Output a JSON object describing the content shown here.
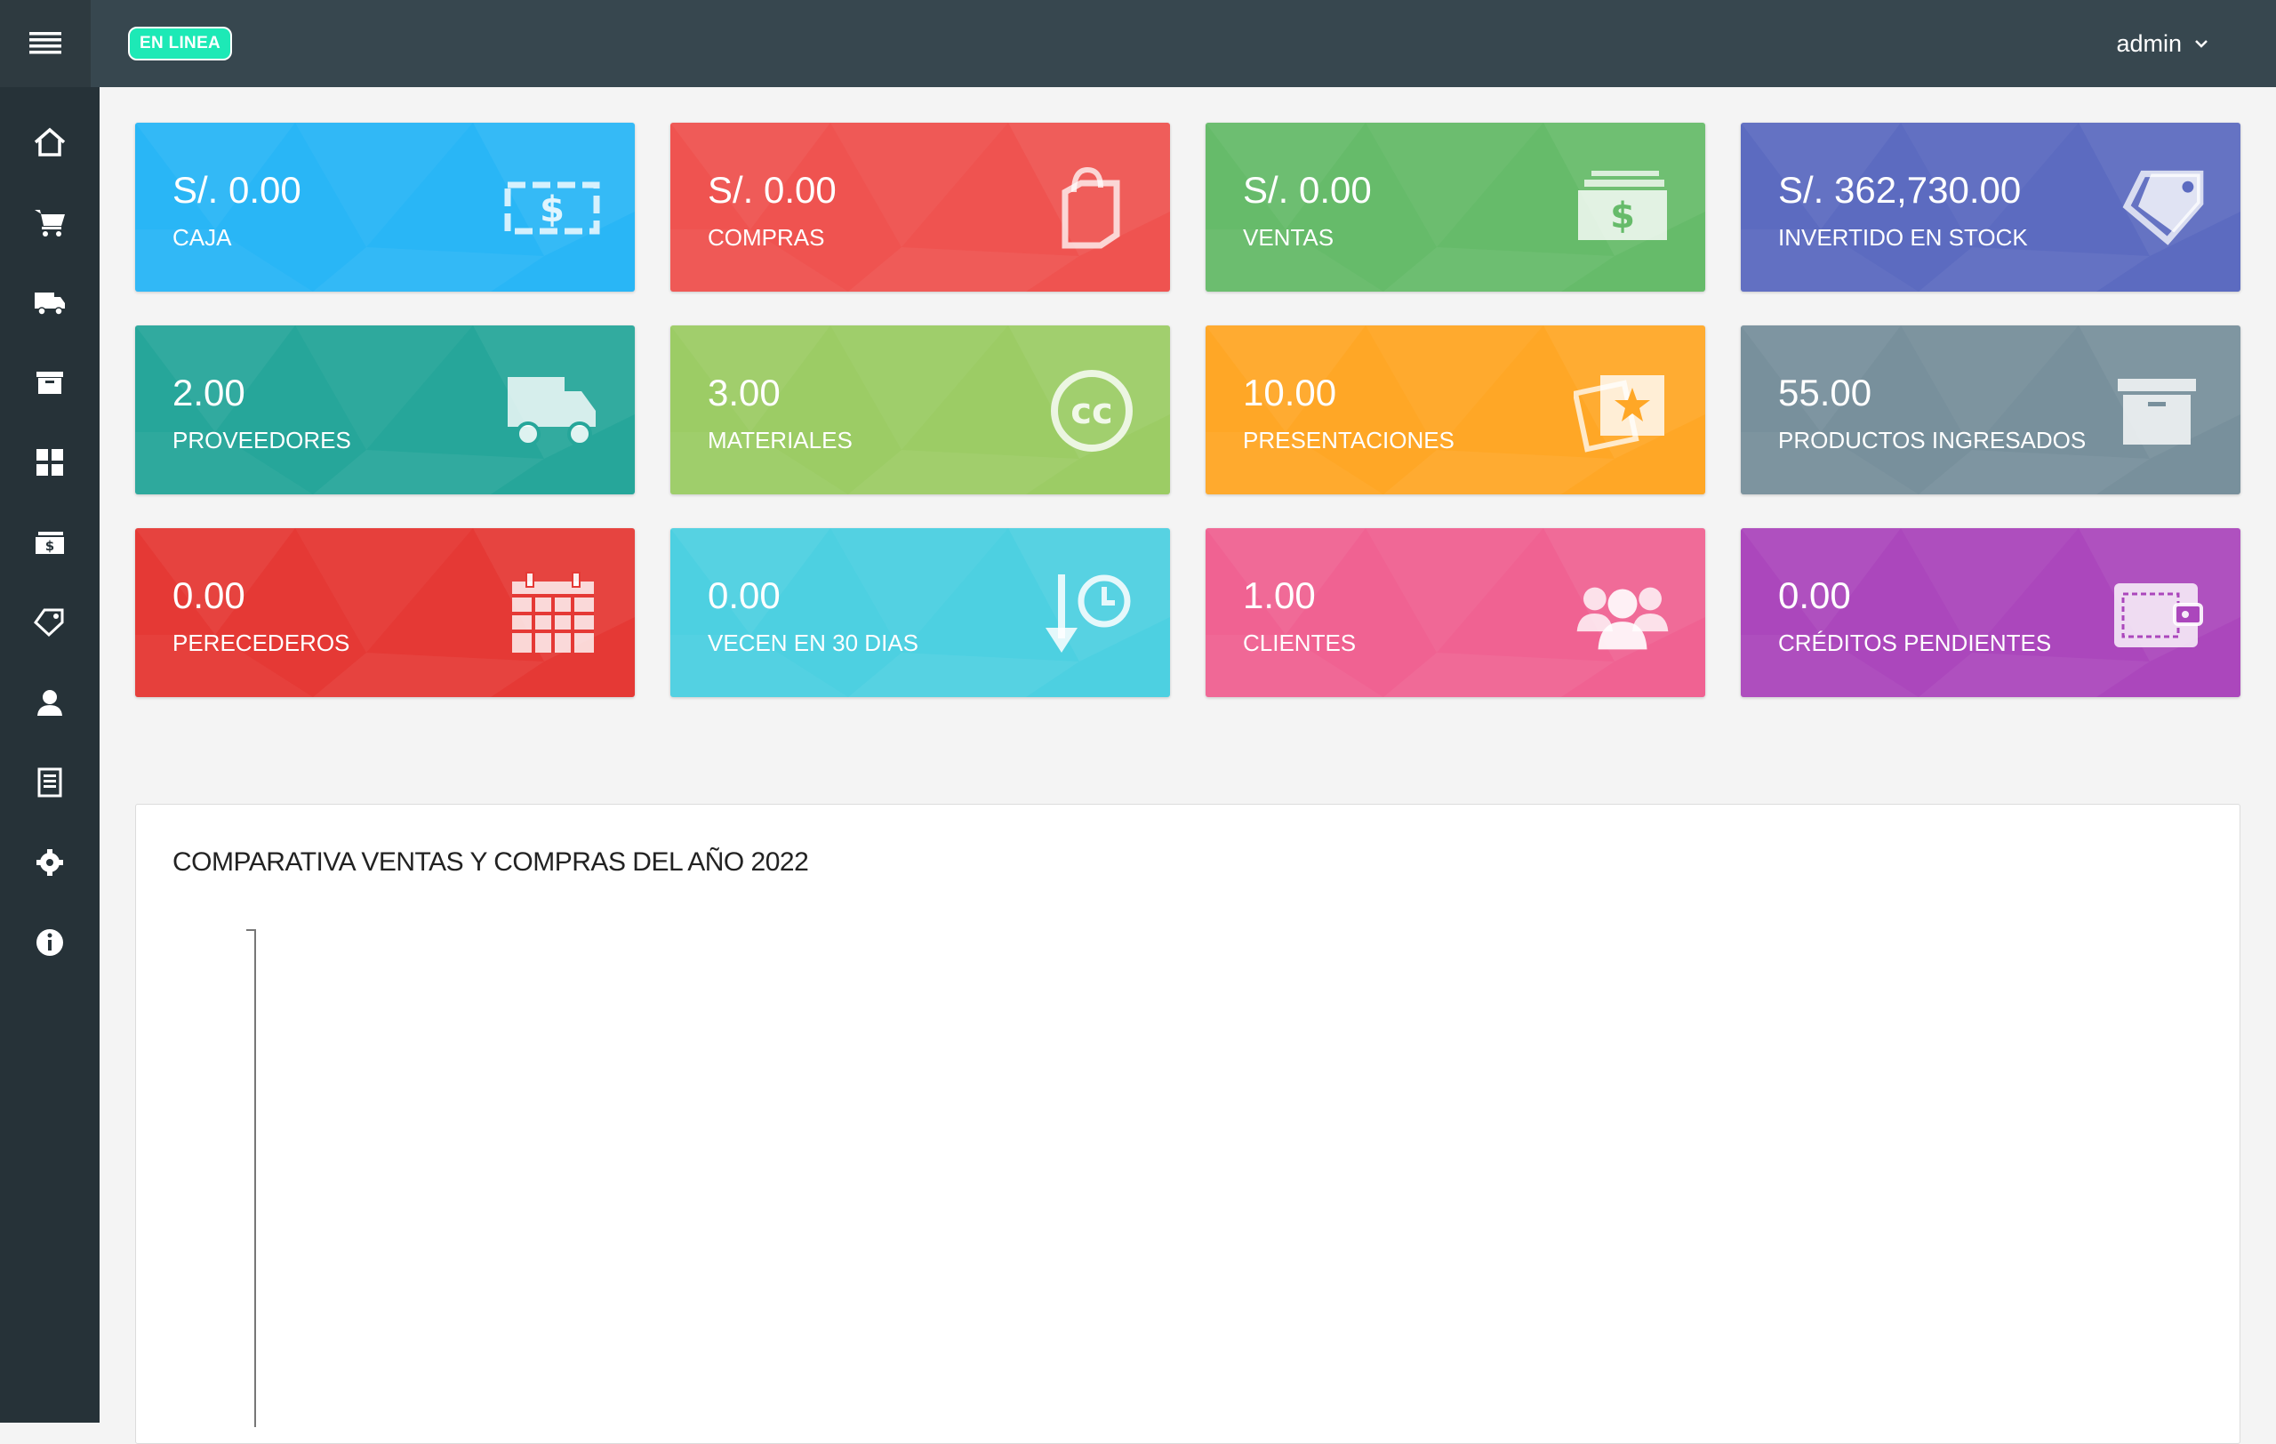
{
  "header": {
    "status_badge": "EN LINEA",
    "user": "admin"
  },
  "sidebar": {
    "items": [
      {
        "icon": "home-icon"
      },
      {
        "icon": "cart-icon"
      },
      {
        "icon": "truck-icon"
      },
      {
        "icon": "archive-icon"
      },
      {
        "icon": "grid-icon"
      },
      {
        "icon": "cash-icon"
      },
      {
        "icon": "tags-icon"
      },
      {
        "icon": "user-icon"
      },
      {
        "icon": "report-icon"
      },
      {
        "icon": "gear-icon"
      },
      {
        "icon": "info-icon"
      }
    ]
  },
  "cards": [
    {
      "value": "S/. 0.00",
      "label": "CAJA",
      "color": "#29b6f6",
      "icon": "money-icon"
    },
    {
      "value": "S/. 0.00",
      "label": "COMPRAS",
      "color": "#ef5350",
      "icon": "shopping-bag-icon"
    },
    {
      "value": "S/. 0.00",
      "label": "VENTAS",
      "color": "#66bb6a",
      "icon": "money-stack-icon"
    },
    {
      "value": "S/. 362,730.00",
      "label": "INVERTIDO EN STOCK",
      "color": "#5c6bc0",
      "icon": "tags-icon"
    },
    {
      "value": "2.00",
      "label": "PROVEEDORES",
      "color": "#26a69a",
      "icon": "truck-icon"
    },
    {
      "value": "3.00",
      "label": "MATERIALES",
      "color": "#9ccc65",
      "icon": "creative-commons-icon"
    },
    {
      "value": "10.00",
      "label": "PRESENTACIONES",
      "color": "#ffa726",
      "icon": "photos-icon"
    },
    {
      "value": "55.00",
      "label": "PRODUCTOS INGRESADOS",
      "color": "#78909c",
      "icon": "archive-icon"
    },
    {
      "value": "0.00",
      "label": "PERECEDEROS",
      "color": "#e53935",
      "icon": "calendar-icon"
    },
    {
      "value": "0.00",
      "label": "VECEN EN 30 DIAS",
      "color": "#4dd0e1",
      "icon": "history-icon"
    },
    {
      "value": "1.00",
      "label": "CLIENTES",
      "color": "#f06292",
      "icon": "users-icon"
    },
    {
      "value": "0.00",
      "label": "CRÉDITOS PENDIENTES",
      "color": "#ab47bc",
      "icon": "wallet-icon"
    }
  ],
  "chart_panel": {
    "title": "COMPARATIVA VENTAS Y COMPRAS DEL AÑO 2022"
  },
  "chart_data": {
    "type": "bar",
    "title": "COMPARATIVA VENTAS Y COMPRAS DEL AÑO 2022",
    "categories": [],
    "series": []
  }
}
